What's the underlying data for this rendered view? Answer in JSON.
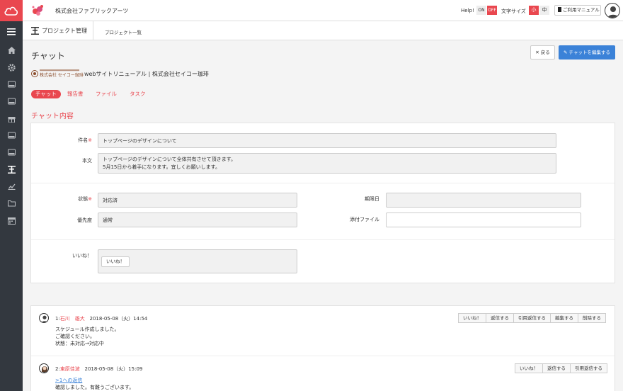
{
  "header": {
    "company": "株式会社ファブリックアーツ",
    "help_label": "Help!",
    "help_on": "ON",
    "help_off": "OFF",
    "font_size_label": "文字サイズ",
    "font_small": "小",
    "font_medium": "中",
    "manual_label": "ご利用マニュアル"
  },
  "subnav": {
    "active": "プロジェクト管理",
    "link": "プロジェクト一覧"
  },
  "page": {
    "title": "チャット",
    "back_label": "戻る",
    "edit_label": "チャットを編集する",
    "project_logo_text": "株式会社 セイコー珈琲",
    "project_name": "webサイトリニューアル | 株式会社セイコー珈琲"
  },
  "tabs": [
    "チャット",
    "報告書",
    "ファイル",
    "タスク"
  ],
  "section_title": "チャット内容",
  "form": {
    "subject_label": "件名",
    "required_mark": "※",
    "subject_value": "トップページのデザインについて",
    "body_label": "本文",
    "body_line1": "トップページのデザインについて全体共有させて頂きます。",
    "body_line2": "5月15日から着手になります。宜しくお願いします。",
    "status_label": "状態",
    "status_value": "対応済",
    "deadline_label": "期限日",
    "deadline_value": "",
    "priority_label": "優先度",
    "priority_value": "通常",
    "attachment_label": "添付ファイル",
    "attachment_value": "",
    "like_label": "いいね！",
    "like_button": "いいね！"
  },
  "messages": [
    {
      "num": "1:",
      "name": "石川　雄大",
      "datetime": "2018-05-08（火）14:54",
      "lines": [
        "スケジュール作成しました。",
        "ご確認ください。",
        "状態：未対応→対応中"
      ],
      "buttons": [
        "いいね！",
        "返信する",
        "引用返信する",
        "編集する",
        "削除する"
      ]
    },
    {
      "num": "2:",
      "name": "東原佳波",
      "datetime": "2018-05-08（火）15:09",
      "reply_link": ">1への返信",
      "lines": [
        "確認しました。有難うございます。"
      ],
      "buttons": [
        "いいね！",
        "返信する",
        "引用返信する"
      ]
    }
  ]
}
